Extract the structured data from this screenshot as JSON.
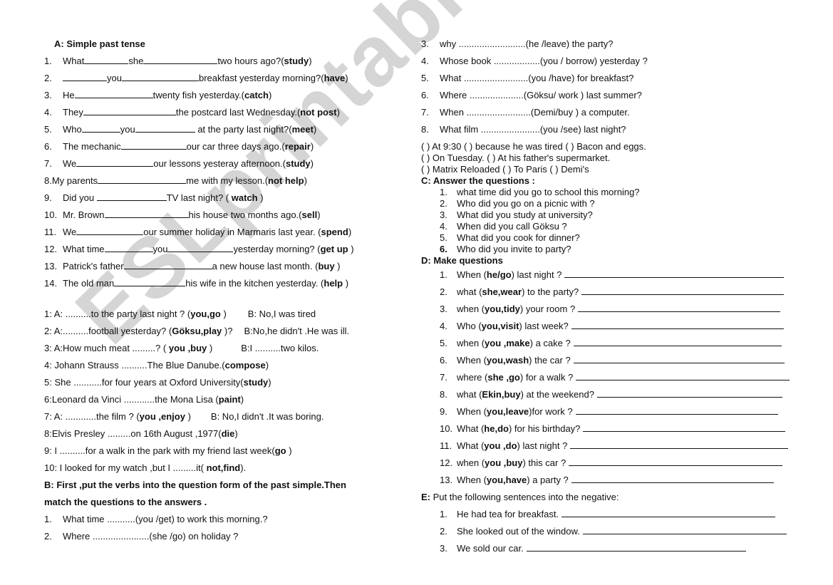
{
  "watermark": "ESLprintables.com",
  "sectionA": {
    "title": "A: Simple past tense",
    "items": [
      {
        "n": "1.",
        "parts": [
          "What",
          "she",
          "two hours ago?("
        ],
        "verb": "study",
        "end": ")"
      },
      {
        "n": "2.",
        "parts": [
          "",
          "you",
          "breakfast yesterday morning?("
        ],
        "verb": "have",
        "end": ")"
      },
      {
        "n": "3.",
        "parts": [
          "He",
          "twenty fish yesterday.("
        ],
        "verb": "catch",
        "end": ")"
      },
      {
        "n": "4.",
        "parts": [
          "They",
          "the postcard last Wednesday.("
        ],
        "verb": "not post",
        "end": ")"
      },
      {
        "n": "5.",
        "parts": [
          "Who",
          "you",
          " at the party last night?("
        ],
        "verb": "meet",
        "end": ")"
      },
      {
        "n": "6.",
        "parts": [
          "The mechanic",
          "our car three days ago.("
        ],
        "verb": "repair",
        "end": ")"
      },
      {
        "n": "7.",
        "parts": [
          "We",
          "our lessons yesteray afternoon.("
        ],
        "verb": "study",
        "end": ")"
      },
      {
        "n": "8.",
        "parts": [
          "My parents",
          "me with my lesson.("
        ],
        "verb": "not help",
        "end": ")"
      },
      {
        "n": "9.",
        "parts": [
          "Did you ",
          "TV last night? ( "
        ],
        "verb": "watch",
        "end": " )"
      },
      {
        "n": "10.",
        "parts": [
          "Mr. Brown",
          "his house two months ago.("
        ],
        "verb": "sell",
        "end": ")"
      },
      {
        "n": "11.",
        "parts": [
          "We",
          "our summer holiday in Marmaris last year. ("
        ],
        "verb": "spend",
        "end": ")"
      },
      {
        "n": "12.",
        "parts": [
          "What time",
          "you",
          "yesterday morning? ("
        ],
        "verb": "get up",
        "end": " )"
      },
      {
        "n": "13.",
        "parts": [
          "Patrick's father",
          "a new house last month. ("
        ],
        "verb": "buy",
        "end": " )"
      },
      {
        "n": "14.",
        "parts": [
          "The old man",
          "his wife in the kitchen yesterday. ("
        ],
        "verb": "help",
        "end": " )"
      }
    ]
  },
  "dotted": [
    {
      "pre": "1: A: ..........to the party last night ? (",
      "verb": "you,go",
      "post": " )",
      "answer": "B: No,I was tired"
    },
    {
      "pre": "2: A:..........football yesterday? (",
      "verb": "Göksu,play",
      "post": " )?",
      "answer": "B:No,he didn't .He was ill."
    },
    {
      "pre": "3: A:How much meat .........? ( ",
      "verb": "you ,buy",
      "post": " )",
      "answer": "B:I ..........two kilos."
    },
    {
      "pre": "4: Johann Strauss ..........The Blue Danube.(",
      "verb": "compose",
      "post": ")",
      "answer": ""
    },
    {
      "pre": "5: She ...........for four years at Oxford University(",
      "verb": "study",
      "post": ")",
      "answer": ""
    },
    {
      "pre": "6:Leonard da Vinci ............the Mona Lisa  (",
      "verb": "paint",
      "post": ")",
      "answer": ""
    },
    {
      "pre": "7: A: ............the film ? (",
      "verb": "you ,enjoy",
      "post": " )",
      "answer": "B: No,I didn't .It was boring."
    },
    {
      "pre": "8:Elvis Presley .........on 16th August ,1977(",
      "verb": "die",
      "post": ")",
      "answer": ""
    },
    {
      "pre": "9: I ..........for a walk in the park with my friend last week(",
      "verb": "go",
      "post": " )",
      "answer": ""
    },
    {
      "pre": "10: I looked for my watch ,but I .........it( ",
      "verb": "not,find",
      "post": ").",
      "answer": ""
    }
  ],
  "sectionB": {
    "title_line1": "B: First ,put the verbs into the question form of the past simple.Then",
    "title_line2": "match the questions to the answers .",
    "questions": [
      {
        "n": "1.",
        "text": "What time ...........(you /get) to work this morning.?"
      },
      {
        "n": "2.",
        "text": "Where ......................(she /go)  on holiday ?"
      },
      {
        "n": "3.",
        "text": "why ..........................(he /leave) the party?"
      },
      {
        "n": "4.",
        "text": "Whose book ..................(you / borrow) yesterday ?"
      },
      {
        "n": "5.",
        "text": "What .........................(you /have) for breakfast?"
      },
      {
        "n": "6.",
        "text": "Where .....................(Göksu/ work ) last summer?"
      },
      {
        "n": "7.",
        "text": "When .........................(Demi/buy ) a computer."
      },
      {
        "n": "8.",
        "text": "What film .......................(you /see) last night?"
      }
    ],
    "answers": [
      "( ) At 9:30 ( ) because he was tired  ( ) Bacon and eggs.",
      "( ) On Tuesday.  ( ) At his father's supermarket.",
      "( ) Matrix Reloaded ( ) To Paris      ( ) Demi's"
    ]
  },
  "sectionC": {
    "title": "C: Answer the questions :",
    "items": [
      {
        "n": "1.",
        "text": "what time did you go to school this morning?"
      },
      {
        "n": "2.",
        "text": "Who did you go on a picnic with ?"
      },
      {
        "n": "3.",
        "text": "What did you study at university?"
      },
      {
        "n": "4.",
        "text": "When did you call Göksu ?"
      },
      {
        "n": "5.",
        "text": "What did you cook for dinner?"
      },
      {
        "n": "6.",
        "text": "Who did you invite to party?"
      }
    ]
  },
  "sectionD": {
    "title": "D: Make questions",
    "items": [
      {
        "n": "1.",
        "pre": "When  (",
        "bold": "he/go",
        "post": " ) last night ?"
      },
      {
        "n": "2.",
        "pre": "what (",
        "bold": "she,wear",
        "post": ") to the party?"
      },
      {
        "n": "3.",
        "pre": "when (",
        "bold": "you,tidy",
        "post": " ) your room ?"
      },
      {
        "n": "4.",
        "pre": "Who (",
        "bold": "you,visit",
        "post": ") last week?"
      },
      {
        "n": "5.",
        "pre": "when (",
        "bold": "you ,make",
        "post": " ) a cake ?"
      },
      {
        "n": "6.",
        "pre": "When (",
        "bold": "you,wash",
        "post": ") the car ?"
      },
      {
        "n": "7.",
        "pre": "where (",
        "bold": "she ,go",
        "post": " ) for a walk ?"
      },
      {
        "n": "8.",
        "pre": "what (",
        "bold": "Ekin,buy",
        "post": " ) at the weekend?"
      },
      {
        "n": "9.",
        "pre": "When (",
        "bold": "you,leave",
        "post": " )for work ?"
      },
      {
        "n": "10.",
        "pre": "What (",
        "bold": "he,do",
        "post": " ) for his birthday?"
      },
      {
        "n": "11.",
        "pre": "What (",
        "bold": "you ,do",
        "post": ") last night ?"
      },
      {
        "n": "12.",
        "pre": "when (",
        "bold": "you ,buy",
        "post": " ) this car ?"
      },
      {
        "n": "13.",
        "pre": "When (",
        "bold": "you,have",
        "post": " ) a party ?"
      }
    ]
  },
  "sectionE": {
    "label": "E:",
    "title": " Put the following sentences into the negative:",
    "items": [
      {
        "n": "1.",
        "text": "He had tea for breakfast."
      },
      {
        "n": "2.",
        "text": "She looked out of the window."
      },
      {
        "n": "3.",
        "text": "We sold our car."
      }
    ]
  }
}
